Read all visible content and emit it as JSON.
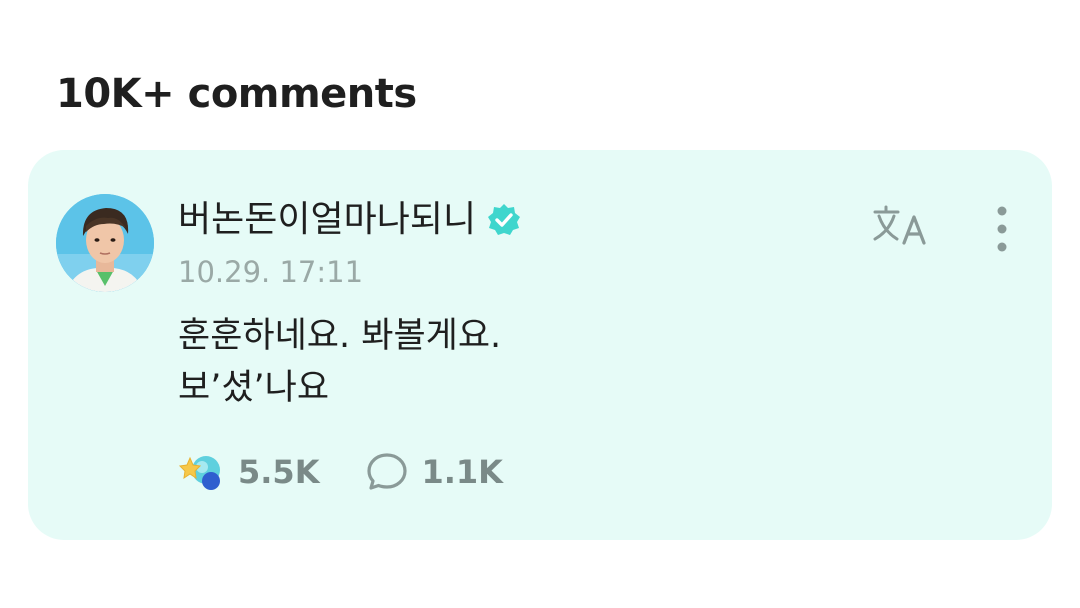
{
  "section": {
    "title": "10K+ comments"
  },
  "comment": {
    "author": "버논돈이얼마나되니",
    "verified": true,
    "timestamp": "10.29. 17:11",
    "lines": [
      "훈훈하네요. 봐볼게요.",
      "보’셨’나요"
    ],
    "reaction_count": "5.5K",
    "reply_count": "1.1K"
  },
  "colors": {
    "card_background": "#e6fbf7",
    "verified_badge": "#3fd6cd",
    "muted_text": "#7a8a88"
  },
  "icons": {
    "verified": "verified-badge-icon",
    "translate": "translate-icon",
    "more": "more-vertical-icon",
    "reaction": "reaction-icon",
    "reply": "comment-bubble-icon"
  }
}
